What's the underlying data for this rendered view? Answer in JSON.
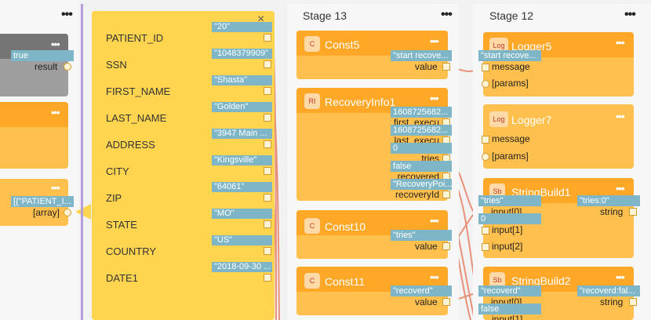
{
  "left_nodes": {
    "gray_chip": "true",
    "gray_port": "result",
    "array_chip": "[{\"PATIENT_I...",
    "array_port": "[array]"
  },
  "patient_panel": {
    "close_glyph": "×",
    "fields": [
      {
        "label": "PATIENT_ID",
        "value": "\"20\""
      },
      {
        "label": "SSN",
        "value": "\"1048379909\""
      },
      {
        "label": "FIRST_NAME",
        "value": "\"Shasta\""
      },
      {
        "label": "LAST_NAME",
        "value": "\"Golden\""
      },
      {
        "label": "ADDRESS",
        "value": "\"3947 Main ..."
      },
      {
        "label": "CITY",
        "value": "\"Kingsville\""
      },
      {
        "label": "ZIP",
        "value": "\"64061\""
      },
      {
        "label": "STATE",
        "value": "\"MO\""
      },
      {
        "label": "COUNTRY",
        "value": "\"US\""
      },
      {
        "label": "DATE1",
        "value": "\"2018-09-30 ..."
      }
    ]
  },
  "stage13": {
    "title": "Stage 13",
    "menu": "•••",
    "const5": {
      "icon": "C",
      "title": "Const5",
      "chip": "\"start recove...",
      "port": "value"
    },
    "recovery": {
      "icon": "RI",
      "title": "RecoveryInfo1",
      "ports": [
        {
          "label": "first_execu",
          "chip": "1608725682..."
        },
        {
          "label": "last_execu",
          "chip": "1608725682..."
        },
        {
          "label": "tries",
          "chip": "0"
        },
        {
          "label": "recovered",
          "chip": "false"
        },
        {
          "label": "recoveryId",
          "chip": "\"RecoveryPoi..."
        }
      ]
    },
    "const10": {
      "icon": "C",
      "title": "Const10",
      "chip": "\"tries\"",
      "port": "value"
    },
    "const11": {
      "icon": "C",
      "title": "Const11",
      "chip": "\"recoverd\"",
      "port": "value"
    }
  },
  "stage12": {
    "title": "Stage 12",
    "menu": "•••",
    "logger5": {
      "icon": "Log",
      "title": "Logger5",
      "chip": "\"start recove...",
      "port1": "message",
      "port2": "[params]"
    },
    "logger7": {
      "icon": "Log",
      "title": "Logger7",
      "port1": "message",
      "port2": "[params]"
    },
    "sb1": {
      "icon": "Sb",
      "title": "StringBuild1",
      "in0_chip": "\"tries\"",
      "in0": "input[0]",
      "in1_chip": "0",
      "in1": "input[1]",
      "in2": "input[2]",
      "out_chip": "\"tries:0\"",
      "out": "string"
    },
    "sb2": {
      "icon": "Sb",
      "title": "StringBuild2",
      "in0_chip": "\"recoverd\"",
      "in0": "input[0]",
      "in1_chip": "false",
      "in1": "input[1]",
      "out_chip": "\"recoverd:fal...",
      "out": "string"
    }
  },
  "node_menu": "•••",
  "colors": {
    "node_head": "#ffa726",
    "node_body": "#ffc04d",
    "panel": "#ffd54f",
    "chip": "#7fb6c7",
    "wire": "#e8907a",
    "divider": "#b39ddb"
  }
}
